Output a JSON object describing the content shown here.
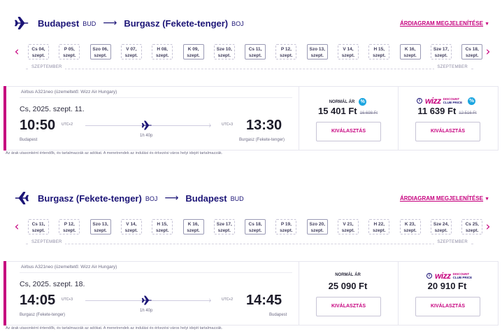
{
  "outbound": {
    "from_city": "Budapest",
    "from_code": "BUD",
    "to_city": "Burgasz (Fekete-tenger)",
    "to_code": "BOJ",
    "fare_link": "ÁRDIAGRAM MEGJELENÍTÉSE",
    "month_left": "SZEPTEMBER",
    "month_right": "SZEPTEMBER",
    "dates": [
      {
        "day": "Cs 04,",
        "label": "szept.",
        "boxed": false
      },
      {
        "day": "P 05,",
        "label": "szept.",
        "boxed": false
      },
      {
        "day": "Szo 06,",
        "label": "szept.",
        "boxed": true
      },
      {
        "day": "V 07,",
        "label": "szept.",
        "boxed": false
      },
      {
        "day": "H 08,",
        "label": "szept.",
        "boxed": false
      },
      {
        "day": "K 09,",
        "label": "szept.",
        "boxed": true
      },
      {
        "day": "Sze 10,",
        "label": "szept.",
        "boxed": false
      },
      {
        "day": "Cs 11,",
        "label": "szept.",
        "boxed": true
      },
      {
        "day": "P 12,",
        "label": "szept.",
        "boxed": false
      },
      {
        "day": "Szo 13,",
        "label": "szept.",
        "boxed": true
      },
      {
        "day": "V 14,",
        "label": "szept.",
        "boxed": false
      },
      {
        "day": "H 15,",
        "label": "szept.",
        "boxed": false
      },
      {
        "day": "K 16,",
        "label": "szept.",
        "boxed": true
      },
      {
        "day": "Sze 17,",
        "label": "szept.",
        "boxed": false
      },
      {
        "day": "Cs 18,",
        "label": "szept.",
        "boxed": true
      }
    ],
    "aircraft": "Airbus A321neo (üzemeltető: Wizz Air Hungary)",
    "date": "Cs, 2025. szept. 11.",
    "dep_time": "10:50",
    "arr_time": "13:30",
    "dep_utc": "UTC+2",
    "arr_utc": "UTC+3",
    "duration": "1h 40p",
    "dep_airport": "Budapest",
    "arr_airport": "Burgasz (Fekete-tenger)",
    "normal_label": "NORMÁL ÁR",
    "normal_price": "15 401 Ft",
    "normal_old_price": "16 698 Ft",
    "club_price": "11 639 Ft",
    "club_old_price": "12 516 Ft",
    "select_label": "KIVÁLASZTÁS",
    "note": "Az árak utasonként értendők, és tartalmazzák az adókat. A menetrendek az indulási és érkezési város helyi idejét tartalmazzák."
  },
  "inbound": {
    "from_city": "Burgasz (Fekete-tenger)",
    "from_code": "BOJ",
    "to_city": "Budapest",
    "to_code": "BUD",
    "fare_link": "ÁRDIAGRAM MEGJELENÍTÉSE",
    "month_left": "SZEPTEMBER",
    "month_right": "SZEPTEMBER",
    "dates": [
      {
        "day": "Cs 11,",
        "label": "szept.",
        "boxed": false
      },
      {
        "day": "P 12,",
        "label": "szept.",
        "boxed": false
      },
      {
        "day": "Szo 13,",
        "label": "szept.",
        "boxed": true
      },
      {
        "day": "V 14,",
        "label": "szept.",
        "boxed": false
      },
      {
        "day": "H 15,",
        "label": "szept.",
        "boxed": false
      },
      {
        "day": "K 16,",
        "label": "szept.",
        "boxed": true
      },
      {
        "day": "Sze 17,",
        "label": "szept.",
        "boxed": false
      },
      {
        "day": "Cs 18,",
        "label": "szept.",
        "boxed": true
      },
      {
        "day": "P 19,",
        "label": "szept.",
        "boxed": false
      },
      {
        "day": "Szo 20,",
        "label": "szept.",
        "boxed": true
      },
      {
        "day": "V 21,",
        "label": "szept.",
        "boxed": false
      },
      {
        "day": "H 22,",
        "label": "szept.",
        "boxed": false
      },
      {
        "day": "K 23,",
        "label": "szept.",
        "boxed": false
      },
      {
        "day": "Sze 24,",
        "label": "szept.",
        "boxed": false
      },
      {
        "day": "Cs 25,",
        "label": "szept.",
        "boxed": false
      }
    ],
    "aircraft": "Airbus A321neo (üzemeltető: Wizz Air Hungary)",
    "date": "Cs, 2025. szept. 18.",
    "dep_time": "14:05",
    "arr_time": "14:45",
    "dep_utc": "UTC+3",
    "arr_utc": "UTC+2",
    "duration": "1h 40p",
    "dep_airport": "Burgasz (Fekete-tenger)",
    "arr_airport": "Budapest",
    "normal_label": "NORMÁL ÁR",
    "normal_price": "25 090 Ft",
    "club_price": "20 910 Ft",
    "select_label": "KIVÁLASZTÁS",
    "note": "Az árak utasonként értendők, és tartalmazzák az adókat. A menetrendek az indulási és érkezési város helyi idejét tartalmazzák."
  },
  "club": {
    "logo_word": "wizz",
    "line1": "DISCOUNT",
    "line2": "CLUB PRICE",
    "info_glyph": "i"
  },
  "icons": {
    "percent_glyph": "%",
    "prev_glyph": "‹",
    "next_glyph": "›"
  },
  "colors": {
    "brand_navy": "#1c1577",
    "brand_magenta": "#c6007e",
    "badge_blue": "#1ba5e0"
  }
}
